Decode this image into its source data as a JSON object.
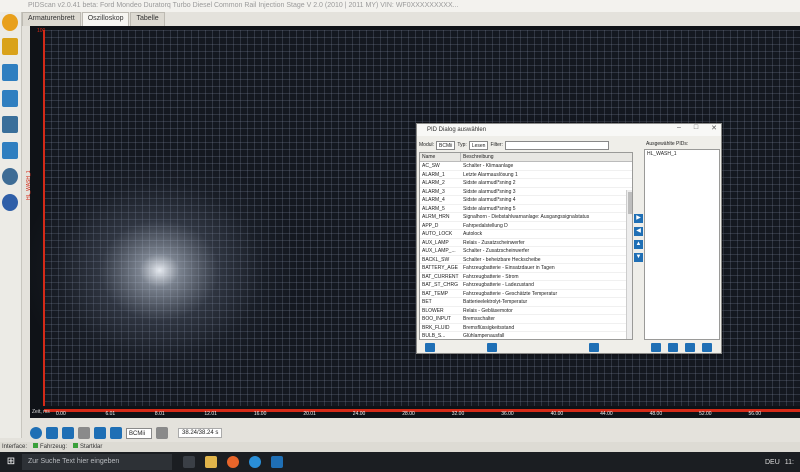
{
  "window": {
    "title": "PIDScan v2.0.41 beta: Ford Mondeo Duratorq Turbo Diesel Common Rail Injection Stage V 2.0 (2010 | 2011 MY) VIN: WF0XXXXXXXXX..."
  },
  "tabs": [
    {
      "label": "Armaturenbrett"
    },
    {
      "label": "Oszilloskop"
    },
    {
      "label": "Tabelle"
    }
  ],
  "scope": {
    "y_label": "HL_WASH_1",
    "top_value": "100",
    "x_label": "Zeit, ms",
    "x_ticks": [
      "0.00",
      "6.01",
      "8.01",
      "12.01",
      "16.00",
      "20.01",
      "24.00",
      "28.00",
      "32.00",
      "36.00",
      "40.00",
      "44.00",
      "48.00",
      "52.00",
      "56.00"
    ]
  },
  "controls": {
    "module_value": "BCMii",
    "time_value": "38.24/38.24 s"
  },
  "status": {
    "interface": "Interface:",
    "vehicle": "Fahrzeug:",
    "start": "Startklar"
  },
  "dialog": {
    "title": "PID Dialog auswählen",
    "modul_label": "Modul:",
    "modul_value": "BCMii",
    "typ_label": "Typ:",
    "typ_value": "Lesen",
    "filter_label": "Filter:",
    "col_name": "Name",
    "col_desc": "Beschreibung",
    "rows": [
      {
        "name": "AC_SW",
        "desc": "Schalter - Klimaanlage"
      },
      {
        "name": "ALARM_1",
        "desc": "Letzte Alarmauslösung 1"
      },
      {
        "name": "ALARM_2",
        "desc": "Sidste alarmudl*sning 2"
      },
      {
        "name": "ALARM_3",
        "desc": "Sidste alarmudl*sning 3"
      },
      {
        "name": "ALARM_4",
        "desc": "Sidste alarmudl*sning 4"
      },
      {
        "name": "ALARM_5",
        "desc": "Sidste alarmudl*sning 5"
      },
      {
        "name": "ALRM_HRN",
        "desc": "Signalhorn - Diebstahlwarnanlage: Ausgangssignalstatus"
      },
      {
        "name": "APP_D",
        "desc": "Fahrpedalstellung D"
      },
      {
        "name": "AUTO_LOCK",
        "desc": "Autolock"
      },
      {
        "name": "AUX_LAMP",
        "desc": "Relais - Zusatzscheinwerfer"
      },
      {
        "name": "AUX_LAMP_...",
        "desc": "Schalter - Zusatzscheinwerfer"
      },
      {
        "name": "BACKL_SW",
        "desc": "Schalter - beheizbare Heckscheibe"
      },
      {
        "name": "BATTERY_AGE",
        "desc": "Fahrzeugbatterie - Einsatzdauer in Tagen"
      },
      {
        "name": "BAT_CURRENT",
        "desc": "Fahrzeugbatterie - Strom"
      },
      {
        "name": "BAT_ST_CHRG",
        "desc": "Fahrzeugbatterie - Ladezustand"
      },
      {
        "name": "BAT_TEMP",
        "desc": "Fahrzeugbatterie - Geschätzte Temperatur"
      },
      {
        "name": "BET",
        "desc": "Batterieelektrolyt-Temperatur"
      },
      {
        "name": "BLOWER",
        "desc": "Relais - Gebläsemotor"
      },
      {
        "name": "BOO_INPUT",
        "desc": "Bremsschalter"
      },
      {
        "name": "BRK_FLUID",
        "desc": "Bremsflüssigkeitsstand"
      },
      {
        "name": "BULB_S...",
        "desc": "Glühlampenausfall"
      }
    ],
    "selected_title": "Ausgewählte PIDs:",
    "selected": [
      "HL_WASH_1"
    ]
  },
  "taskbar": {
    "search_placeholder": "Zur Suche Text hier eingeben",
    "lang": "DEU",
    "time": "11:"
  },
  "colors": {
    "accent": "#1f6fb5",
    "trace": "#d42a18",
    "status_ok": "#3aa03a"
  }
}
